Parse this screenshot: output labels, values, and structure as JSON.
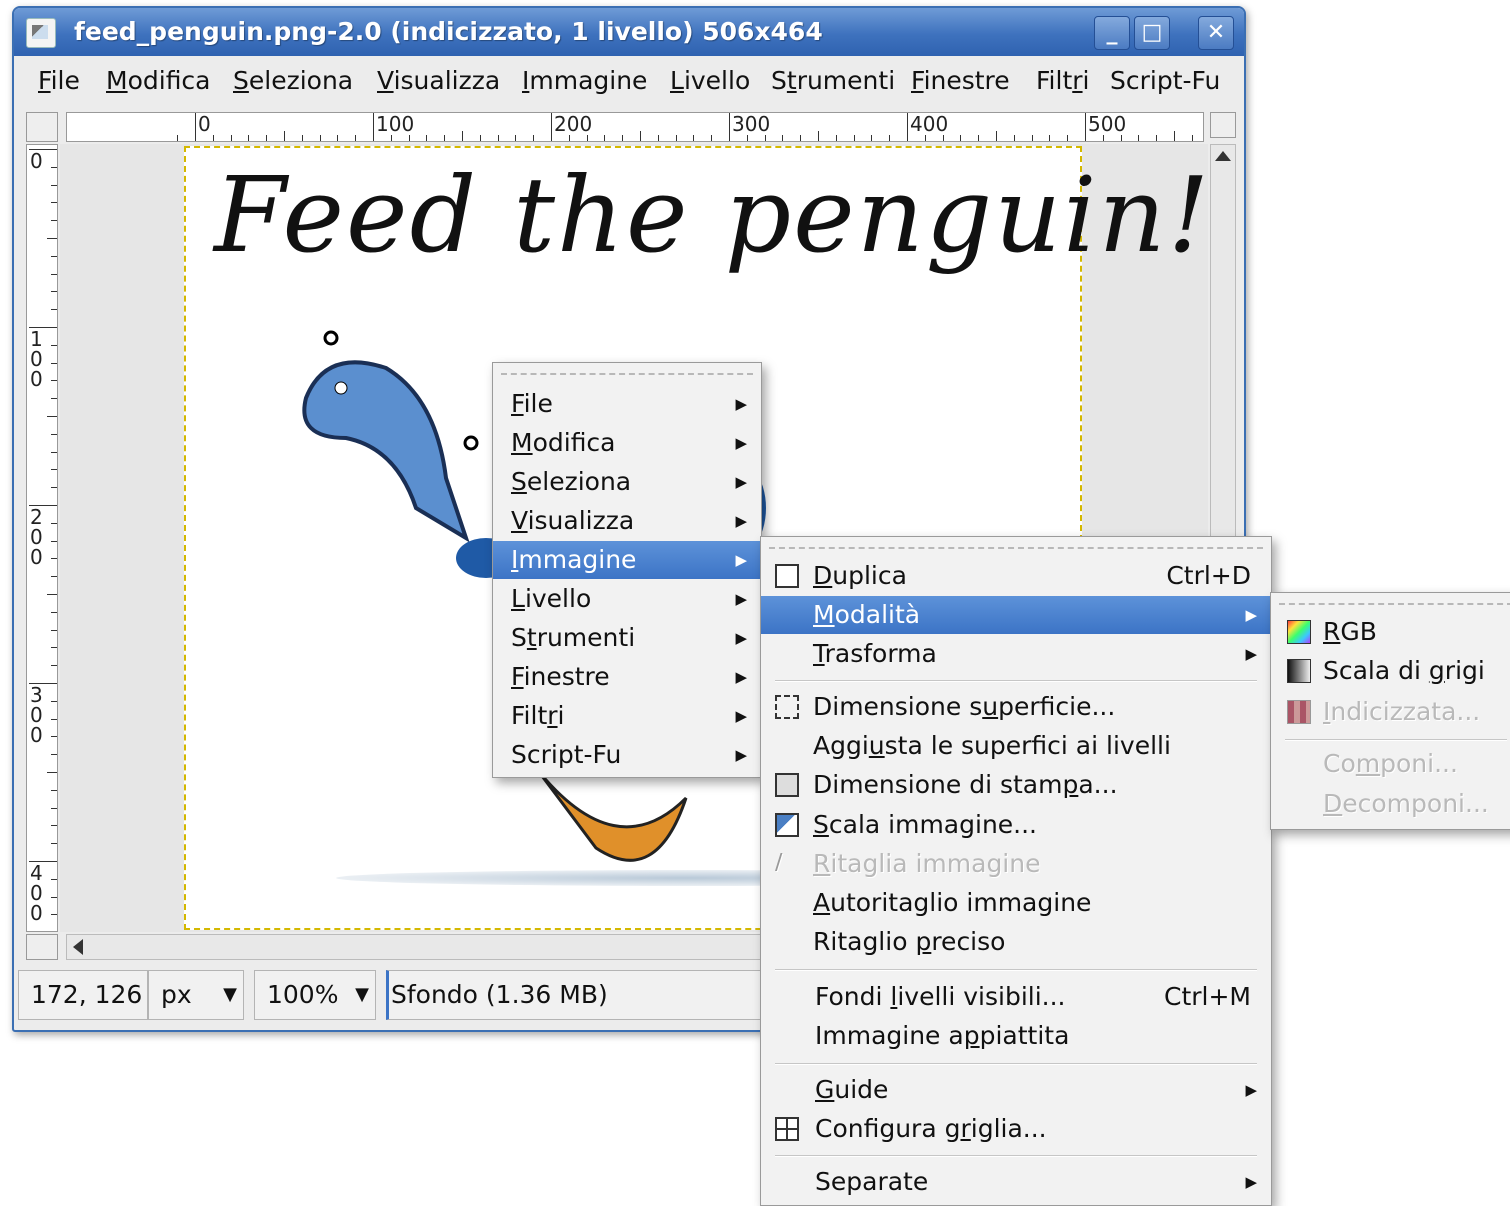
{
  "window": {
    "title": "feed_penguin.png-2.0 (indicizzato, 1 livello) 506x464",
    "minimize": "_",
    "maximize": "□",
    "close": "✕"
  },
  "menubar": [
    "File",
    "Modifica",
    "Seleziona",
    "Visualizza",
    "Immagine",
    "Livello",
    "Strumenti",
    "Finestre",
    "Filtri",
    "Script-Fu"
  ],
  "ruler": {
    "h_labels": [
      "0",
      "100",
      "200",
      "300",
      "400",
      "500"
    ],
    "v_labels": [
      "0",
      "100",
      "200",
      "300",
      "400"
    ]
  },
  "canvas": {
    "image_text": "Feed the penguin!"
  },
  "statusbar": {
    "coords": "172, 126",
    "unit": "px",
    "zoom": "100%",
    "layer_info": "Sfondo (1.36 MB)"
  },
  "context_menu": {
    "items": [
      {
        "pre": "",
        "u": "F",
        "post": "ile"
      },
      {
        "pre": "",
        "u": "M",
        "post": "odifica"
      },
      {
        "pre": "",
        "u": "S",
        "post": "eleziona"
      },
      {
        "pre": "",
        "u": "V",
        "post": "isualizza"
      },
      {
        "pre": "",
        "u": "I",
        "post": "mmagine"
      },
      {
        "pre": "",
        "u": "L",
        "post": "ivello"
      },
      {
        "pre": "S",
        "u": "t",
        "post": "rumenti"
      },
      {
        "pre": "",
        "u": "F",
        "post": "inestre"
      },
      {
        "pre": "Filt",
        "u": "r",
        "post": "i"
      },
      {
        "pre": "Script-Fu",
        "u": "",
        "post": ""
      }
    ]
  },
  "image_menu": {
    "duplica": {
      "pre": "",
      "u": "D",
      "post": "uplica",
      "acc": "Ctrl+D"
    },
    "modalita": {
      "pre": "",
      "u": "M",
      "post": "odalità"
    },
    "trasforma": {
      "pre": "",
      "u": "T",
      "post": "rasforma"
    },
    "dim_superficie": {
      "pre": "Dimensione s",
      "u": "u",
      "post": "perficie..."
    },
    "aggiusta": {
      "pre": "Aggi",
      "u": "u",
      "post": "sta le superfici ai livelli"
    },
    "dim_stampa": {
      "pre": "Dimensione di stam",
      "u": "p",
      "post": "a..."
    },
    "scala": {
      "pre": "",
      "u": "S",
      "post": "cala immagine..."
    },
    "ritaglia": {
      "pre": "",
      "u": "R",
      "post": "itaglia immagine"
    },
    "autoritaglio": {
      "pre": "",
      "u": "A",
      "post": "utoritaglio immagine"
    },
    "ritaglio_preciso": {
      "pre": "Ritaglio ",
      "u": "p",
      "post": "reciso"
    },
    "fondi": {
      "pre": "Fondi ",
      "u": "l",
      "post": "ivelli visibili...",
      "acc": "Ctrl+M"
    },
    "appiattita": {
      "pre": "Immagine a",
      "u": "p",
      "post": "piattita"
    },
    "guide": {
      "pre": "",
      "u": "G",
      "post": "uide"
    },
    "griglia": {
      "pre": "Configura g",
      "u": "r",
      "post": "iglia..."
    },
    "separate": {
      "pre": "Separate",
      "u": "",
      "post": ""
    }
  },
  "mode_menu": {
    "rgb": {
      "pre": "",
      "u": "R",
      "post": "GB"
    },
    "grigi": {
      "pre": "Scala di ",
      "u": "g",
      "post": "rigi"
    },
    "indicizzata": {
      "pre": "",
      "u": "I",
      "post": "ndicizzata..."
    },
    "componi": {
      "pre": "Co",
      "u": "m",
      "post": "poni..."
    },
    "decomponi": {
      "pre": "",
      "u": "D",
      "post": "ecomponi..."
    }
  },
  "colors": {
    "highlight": "#3c74c6",
    "titlebar": "#3e72be",
    "image_border": "#d4b800"
  }
}
